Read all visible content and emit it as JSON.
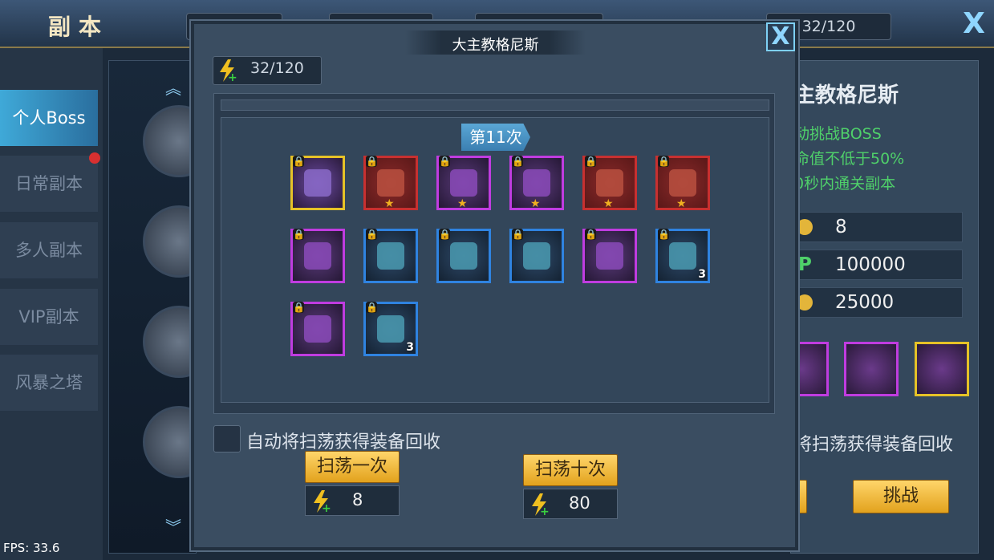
{
  "screen": {
    "title": "副本",
    "energy": "32/120",
    "close_icon": "X",
    "fps": "FPS: 33.6"
  },
  "sidebar": {
    "tabs": [
      {
        "label": "个人Boss",
        "active": true
      },
      {
        "label": "日常副本",
        "active": false
      },
      {
        "label": "多人副本",
        "active": false
      },
      {
        "label": "VIP副本",
        "active": false
      },
      {
        "label": "风暴之塔",
        "active": false
      }
    ]
  },
  "right_panel": {
    "title": "主教格尼斯",
    "conditions": [
      "动挑战BOSS",
      "命值不低于50%",
      "0秒内通关副本"
    ],
    "rows": [
      {
        "icon": "energy-icon",
        "value": "8"
      },
      {
        "icon": "exp-icon",
        "prefix": "P",
        "value": "100000"
      },
      {
        "icon": "gold-coin-icon",
        "value": "25000"
      }
    ],
    "recycle_text": "将扫荡获得装备回收",
    "challenge_label": "挑战"
  },
  "modal": {
    "title": "大主教格尼斯",
    "energy": "32/120",
    "round_label": "第11次",
    "items": [
      {
        "rarity": "gold",
        "locked": true,
        "star": false,
        "count": "",
        "icon": "boss-portrait-icon"
      },
      {
        "rarity": "red",
        "locked": true,
        "star": true,
        "count": "",
        "icon": "bow-icon"
      },
      {
        "rarity": "purple",
        "locked": true,
        "star": true,
        "count": "",
        "icon": "shoulder-armor-icon"
      },
      {
        "rarity": "purple",
        "locked": true,
        "star": true,
        "count": "",
        "icon": "boots-icon"
      },
      {
        "rarity": "red",
        "locked": true,
        "star": true,
        "count": "",
        "icon": "armor-icon"
      },
      {
        "rarity": "red",
        "locked": true,
        "star": true,
        "count": "",
        "icon": "helmet-icon"
      },
      {
        "rarity": "purple",
        "locked": true,
        "star": false,
        "count": "",
        "icon": "green-gem-icon"
      },
      {
        "rarity": "blue",
        "locked": true,
        "star": false,
        "count": "",
        "icon": "gear-ring-icon"
      },
      {
        "rarity": "blue",
        "locked": true,
        "star": false,
        "count": "",
        "icon": "green-plate-icon"
      },
      {
        "rarity": "blue",
        "locked": true,
        "star": false,
        "count": "",
        "icon": "scroll-icon"
      },
      {
        "rarity": "purple",
        "locked": true,
        "star": false,
        "count": "",
        "icon": "purple-feather-icon"
      },
      {
        "rarity": "blue",
        "locked": true,
        "star": false,
        "count": "3",
        "icon": "blue-feather-icon"
      },
      {
        "rarity": "purple",
        "locked": true,
        "star": false,
        "count": "",
        "icon": "orange-crystal-icon"
      },
      {
        "rarity": "blue",
        "locked": true,
        "star": false,
        "count": "3",
        "icon": "spellbook-icon"
      }
    ],
    "auto_recycle_label": "自动将扫荡获得装备回收",
    "sweep_once": {
      "label": "扫荡一次",
      "cost": "8"
    },
    "sweep_ten": {
      "label": "扫荡十次",
      "cost": "80"
    },
    "colors": {
      "gold": "#e6c227",
      "red": "#c83030",
      "purple": "#c03ce0",
      "blue": "#2f83e0"
    }
  }
}
